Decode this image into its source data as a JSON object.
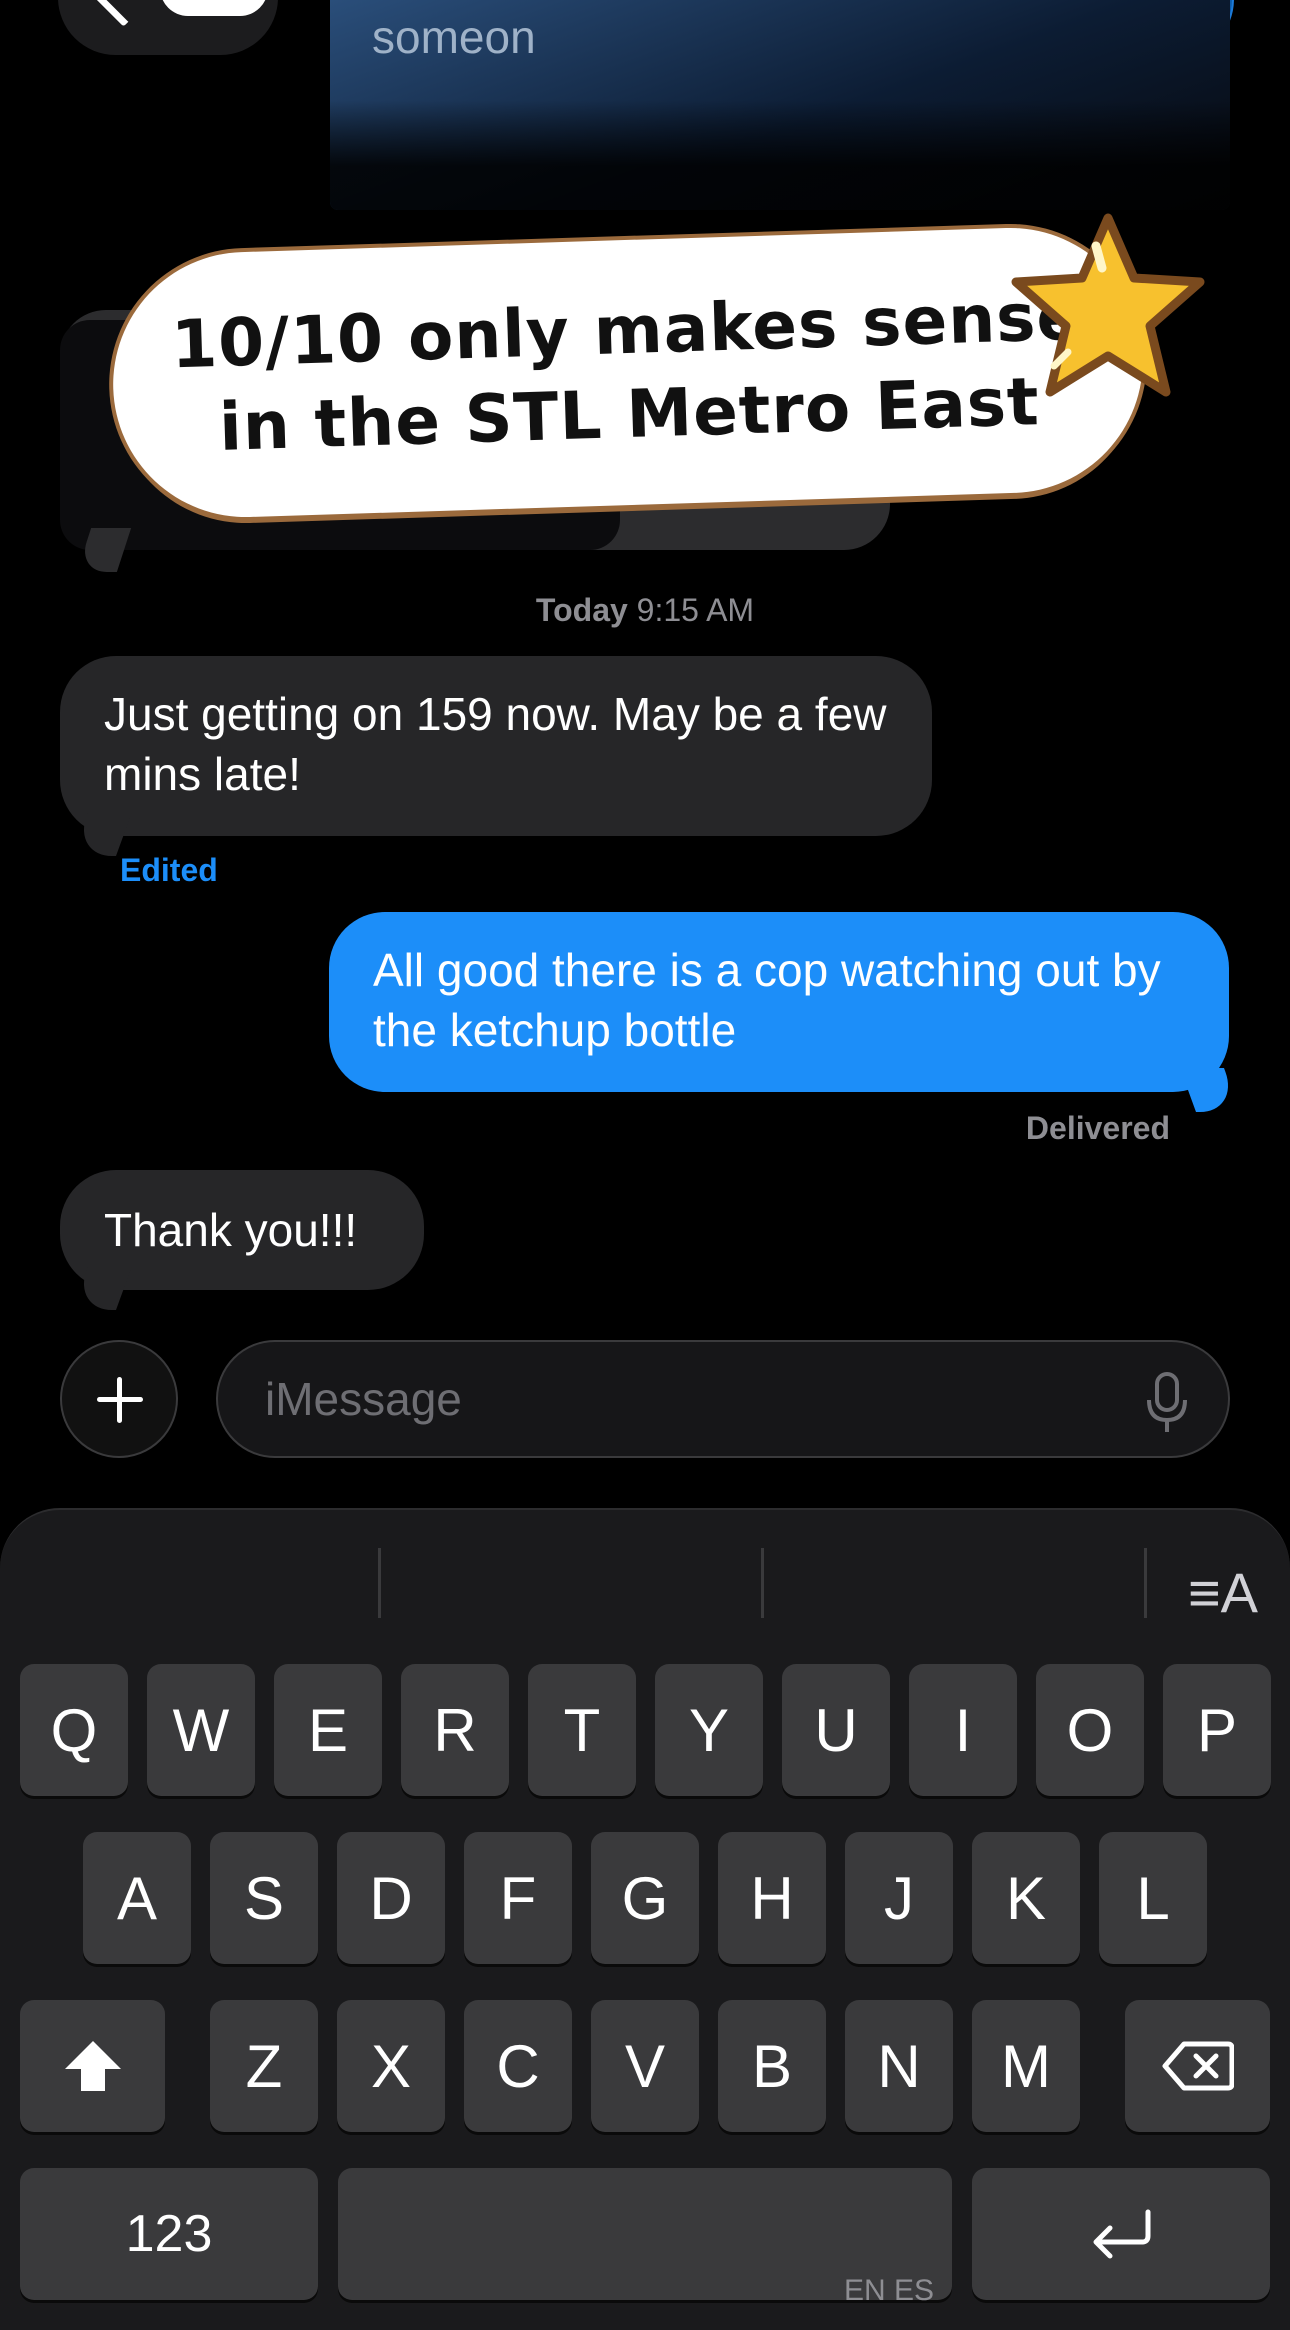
{
  "header": {
    "back_icon": "chevron-left-icon",
    "video_icon": "video-camera-icon"
  },
  "screenshot_preview": {
    "partial_text": "someon"
  },
  "sticker": {
    "line1": "10/10 only makes sense",
    "line2": "in the STL Metro East",
    "icon": "star-icon"
  },
  "timestamp": {
    "day": "Today",
    "time": "9:15 AM"
  },
  "messages": [
    {
      "direction": "received",
      "text": "Just getting on 159 now. May be a few mins late!",
      "meta": "Edited"
    },
    {
      "direction": "sent",
      "text": "All good there is a cop watching out by the ketchup bottle",
      "meta": "Delivered"
    },
    {
      "direction": "received",
      "text": "Thank you!!!"
    }
  ],
  "composer": {
    "placeholder": "iMessage",
    "plus_icon": "plus-icon",
    "mic_icon": "microphone-icon"
  },
  "keyboard": {
    "text_style_label": "≡A",
    "row1": [
      "Q",
      "W",
      "E",
      "R",
      "T",
      "Y",
      "U",
      "I",
      "O",
      "P"
    ],
    "row2": [
      "A",
      "S",
      "D",
      "F",
      "G",
      "H",
      "J",
      "K",
      "L"
    ],
    "row3": [
      "Z",
      "X",
      "C",
      "V",
      "B",
      "N",
      "M"
    ],
    "numbers_label": "123",
    "space_lang": "EN ES",
    "shift_icon": "shift-icon",
    "delete_icon": "delete-icon",
    "return_icon": "return-icon"
  }
}
